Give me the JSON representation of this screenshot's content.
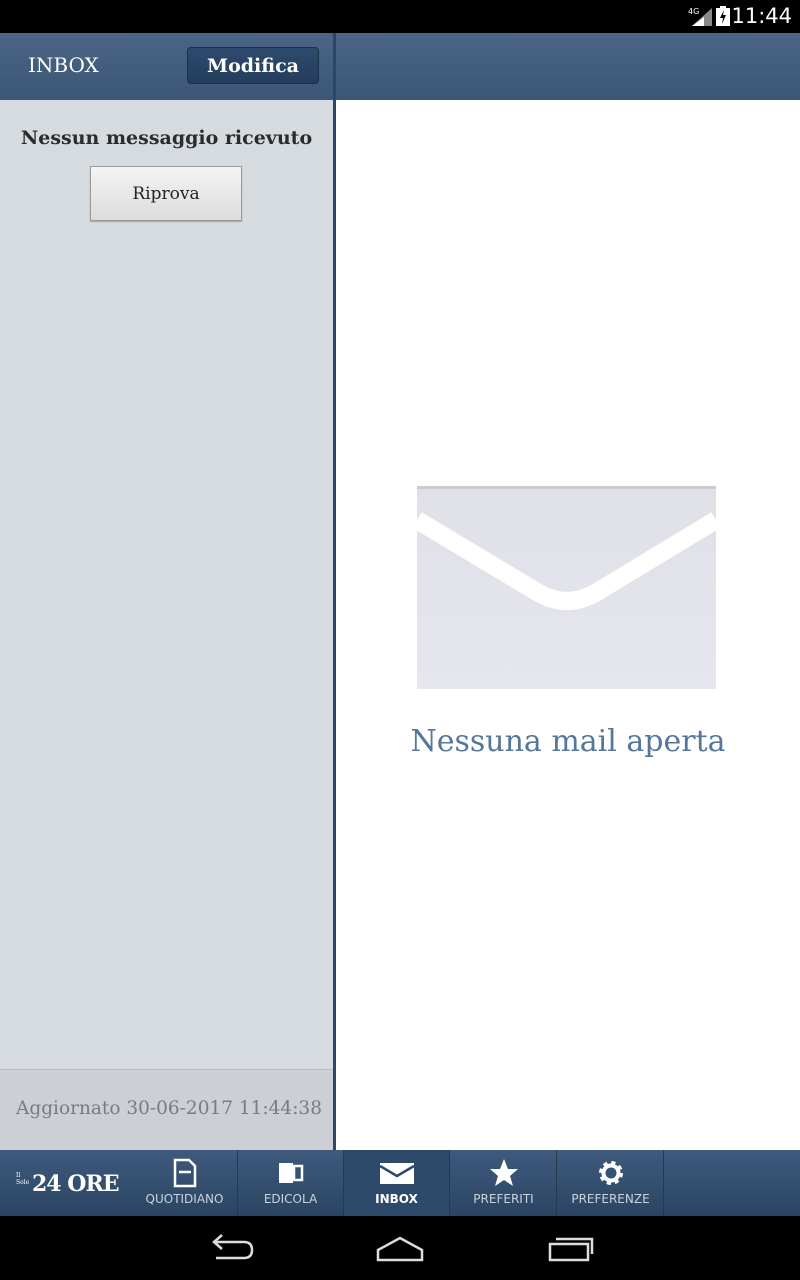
{
  "status_bar": {
    "network": "4G",
    "time": "11:44"
  },
  "inbox_header": {
    "title": "INBOX",
    "edit_label": "Modifica"
  },
  "message_list": {
    "empty_text": "Nessun messaggio ricevuto",
    "retry_label": "Riprova",
    "updated_text": "Aggiornato 30-06-2017 11:44:38"
  },
  "detail": {
    "empty_text": "Nessuna mail aperta"
  },
  "tab_bar": {
    "logo": {
      "small": "Il Sole",
      "big": "24 ORE"
    },
    "tabs": [
      {
        "label": "QUOTIDIANO",
        "icon": "document-icon",
        "active": false
      },
      {
        "label": "EDICOLA",
        "icon": "newsstand-icon",
        "active": false
      },
      {
        "label": "INBOX",
        "icon": "envelope-icon",
        "active": true
      },
      {
        "label": "PREFERITI",
        "icon": "star-icon",
        "active": false
      },
      {
        "label": "PREFERENZE",
        "icon": "gear-icon",
        "active": false
      }
    ]
  },
  "nav_bar": {
    "buttons": [
      "back-icon",
      "home-icon",
      "recent-apps-icon"
    ]
  },
  "colors": {
    "header_blue": "#3c5675",
    "accent_text": "#55779a",
    "panel_gray": "#d6dbe0"
  }
}
